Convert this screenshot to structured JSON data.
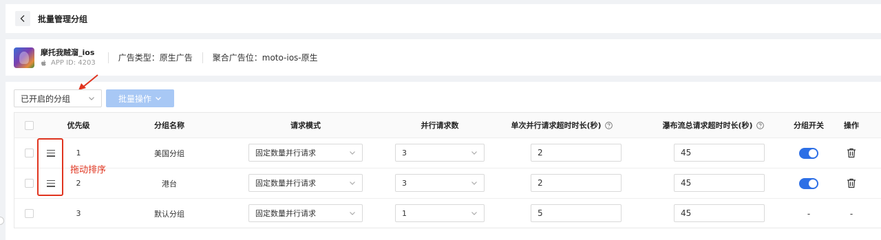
{
  "header": {
    "back_icon": "chevron-left-icon",
    "title": "批量管理分组"
  },
  "app": {
    "name": "摩托我贼溜_ios",
    "platform_icon": "apple-icon",
    "app_id": "APP ID: 4203",
    "ad_type": "广告类型：原生广告",
    "ad_placement": "聚合广告位：moto-ios-原生"
  },
  "toolbar": {
    "filter_select": "已开启的分组",
    "batch_button": "批量操作"
  },
  "annotation": {
    "drag_note": "拖动排序",
    "color": "#e0341f"
  },
  "table": {
    "columns": {
      "priority": "优先级",
      "group_name": "分组名称",
      "request_mode": "请求模式",
      "parallel_count": "并行请求数",
      "single_timeout": "单次并行请求超时时长(秒)",
      "waterfall_timeout": "瀑布流总请求超时时长(秒)",
      "group_switch": "分组开关",
      "actions": "操作"
    },
    "rows": [
      {
        "priority": "1",
        "group_name": "美国分组",
        "request_mode": "固定数量并行请求",
        "parallel_count": "3",
        "single_timeout": "2",
        "waterfall_timeout": "45",
        "enabled": true
      },
      {
        "priority": "2",
        "group_name": "港台",
        "request_mode": "固定数量并行请求",
        "parallel_count": "3",
        "single_timeout": "2",
        "waterfall_timeout": "45",
        "enabled": true
      },
      {
        "priority": "3",
        "group_name": "默认分组",
        "request_mode": "固定数量并行请求",
        "parallel_count": "1",
        "single_timeout": "5",
        "waterfall_timeout": "45",
        "switch_text": "-",
        "action_text": "-"
      }
    ]
  },
  "colors": {
    "accent": "#2d6fe6",
    "batch_button_bg": "#a8c8f5"
  }
}
